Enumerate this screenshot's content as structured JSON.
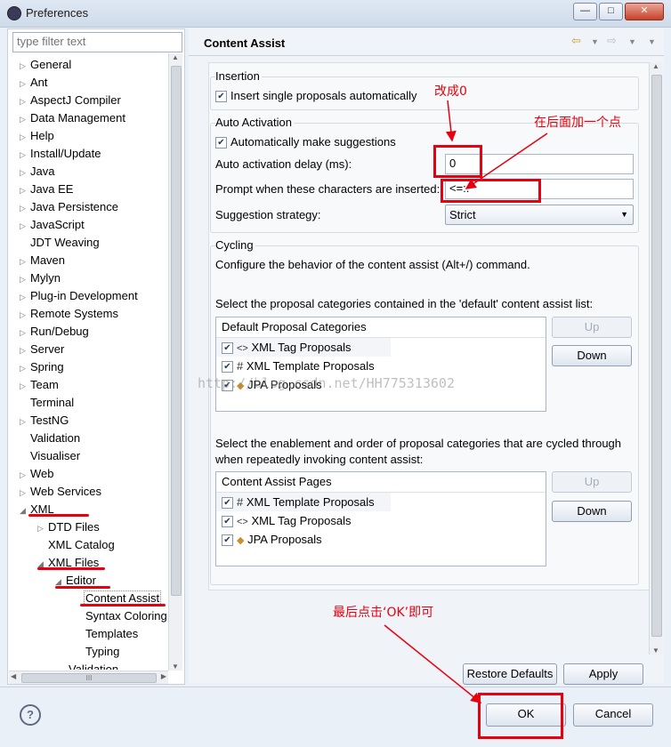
{
  "window": {
    "title": "Preferences",
    "controls": {
      "minimize": "—",
      "maximize": "□",
      "close": "✕"
    }
  },
  "filter": {
    "placeholder": "type filter text"
  },
  "tree": {
    "items": [
      "General",
      "Ant",
      "AspectJ Compiler",
      "Data Management",
      "Help",
      "Install/Update",
      "Java",
      "Java EE",
      "Java Persistence",
      "JavaScript",
      "JDT Weaving",
      "Maven",
      "Mylyn",
      "Plug-in Development",
      "Remote Systems",
      "Run/Debug",
      "Server",
      "Spring",
      "Team",
      "Terminal",
      "TestNG",
      "Validation",
      "Visualiser",
      "Web",
      "Web Services",
      "XML"
    ],
    "xml_children": [
      "DTD Files",
      "XML Catalog",
      "XML Files"
    ],
    "xml_files_children": [
      "Editor"
    ],
    "editor_children": [
      "Content Assist",
      "Syntax Coloring",
      "Templates",
      "Typing"
    ],
    "last_partial": "Validation",
    "hscroll_label": "III"
  },
  "page": {
    "title": "Content Assist",
    "insertion": {
      "heading": "Insertion",
      "insert_single": "Insert single proposals automatically"
    },
    "auto_activation": {
      "heading": "Auto Activation",
      "make_suggestions": "Automatically make suggestions",
      "delay_label": "Auto activation delay (ms):",
      "delay_value": "0",
      "prompt_label": "Prompt when these characters are inserted:",
      "prompt_value": "<=:.",
      "strategy_label": "Suggestion strategy:",
      "strategy_value": "Strict"
    },
    "cycling": {
      "heading": "Cycling",
      "description": "Configure the behavior of the content assist (Alt+/) command.",
      "default_list_label": "Select the proposal categories contained in the 'default' content assist list:",
      "default_header": "Default Proposal Categories",
      "default_items": [
        "XML Tag Proposals",
        "XML Template Proposals",
        "JPA Proposals"
      ],
      "cycle_label_1": "Select the enablement and order of proposal categories that are cycled through",
      "cycle_label_2": "when repeatedly invoking content assist:",
      "pages_header": "Content Assist Pages",
      "pages_items": [
        "XML Template Proposals",
        "XML Tag Proposals",
        "JPA Proposals"
      ],
      "up": "Up",
      "down": "Down"
    },
    "restore_defaults": "Restore Defaults",
    "apply": "Apply"
  },
  "footer": {
    "help": "?",
    "ok": "OK",
    "cancel": "Cancel"
  },
  "annotations": {
    "change_zero": "改成0",
    "add_dot": "在后面加一个点",
    "click_ok": "最后点击‘OK’即可",
    "watermark": "http://blog.csdn.net/HH775313602"
  },
  "colors": {
    "annotation_red": "#e8000e",
    "window_bg": "#eaf0f7"
  }
}
